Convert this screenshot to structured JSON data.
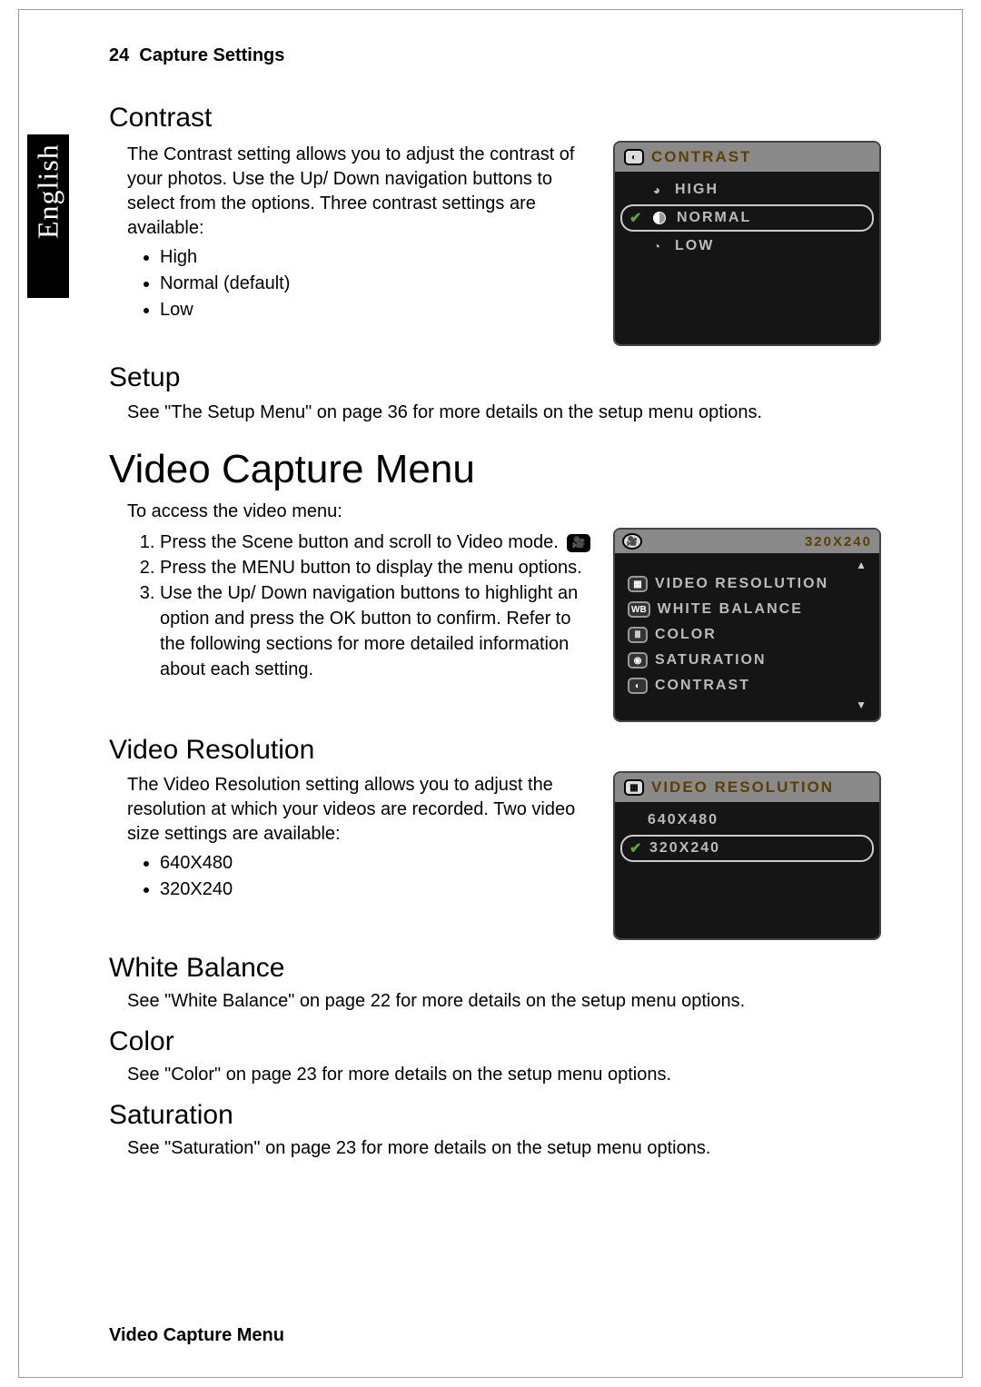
{
  "sidebar": {
    "language": "English"
  },
  "header": {
    "page_number": "24",
    "section_title": "Capture Settings"
  },
  "footer": {
    "text": "Video Capture Menu"
  },
  "contrast": {
    "heading": "Contrast",
    "paragraph": "The Contrast setting allows you to adjust the contrast of your photos. Use the Up/ Down navigation buttons to select from the options. Three contrast settings are available:",
    "bullets": [
      "High",
      "Normal (default)",
      "Low"
    ],
    "lcd": {
      "title": "CONTRAST",
      "items": [
        {
          "label": "HIGH",
          "checked": false,
          "selected": false,
          "icon": "high"
        },
        {
          "label": "NORMAL",
          "checked": true,
          "selected": true,
          "icon": "normal"
        },
        {
          "label": "LOW",
          "checked": false,
          "selected": false,
          "icon": "low"
        }
      ]
    }
  },
  "setup": {
    "heading": "Setup",
    "paragraph": "See \"The Setup Menu\" on page 36 for more details on the setup menu options."
  },
  "video_menu": {
    "heading": "Video Capture Menu",
    "intro": "To access the video menu:",
    "steps": [
      "Press the Scene button and scroll to Video mode.",
      "Press the MENU button to display the menu options.",
      "Use the Up/ Down navigation buttons to highlight an option and press the OK button to confirm. Refer to the following sections for more detailed information about each setting."
    ],
    "lcd": {
      "top_right": "320X240",
      "items": [
        {
          "icon": "VR",
          "label": "VIDEO RESOLUTION"
        },
        {
          "icon": "WB",
          "label": "WHITE BALANCE"
        },
        {
          "icon": "CL",
          "label": "COLOR"
        },
        {
          "icon": "SA",
          "label": "SATURATION"
        },
        {
          "icon": "CT",
          "label": "CONTRAST"
        }
      ]
    }
  },
  "video_res": {
    "heading": "Video Resolution",
    "paragraph": "The Video Resolution setting allows you to adjust the resolution at which your videos are recorded. Two video size settings are available:",
    "bullets": [
      "640X480",
      "320X240"
    ],
    "lcd": {
      "title": "VIDEO RESOLUTION",
      "items": [
        {
          "label": "640X480",
          "checked": false,
          "selected": false
        },
        {
          "label": "320X240",
          "checked": true,
          "selected": true
        }
      ]
    }
  },
  "white_balance": {
    "heading": "White Balance",
    "paragraph": "See \"White Balance\" on page 22 for more details on the setup menu options."
  },
  "color": {
    "heading": "Color",
    "paragraph": "See \"Color\" on page 23 for more details on the setup menu options."
  },
  "saturation": {
    "heading": "Saturation",
    "paragraph": "See \"Saturation\" on page 23 for more details on the setup menu options."
  }
}
